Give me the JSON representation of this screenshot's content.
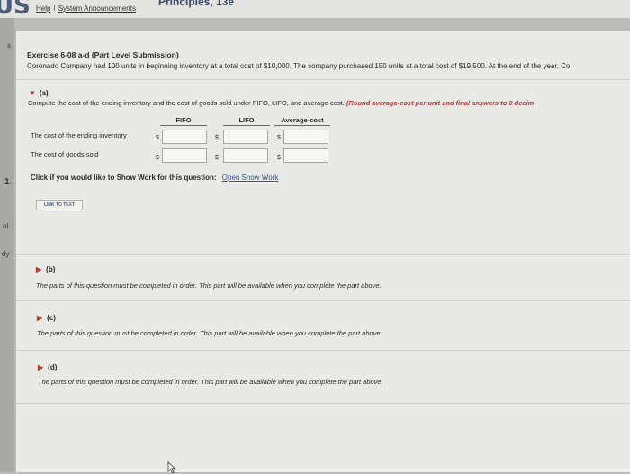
{
  "header": {
    "brand_text": "US",
    "course_title_fragment": "Principles, 13e",
    "help_link": "Help",
    "separator": "I",
    "announcements_link": "System Announcements"
  },
  "left_rail": {
    "marks": [
      "s",
      "1",
      "ol",
      "dy"
    ]
  },
  "exercise": {
    "title": "Exercise 6-08 a-d (Part Level Submission)",
    "intro": "Coronado Company had 100 units in beginning inventory at a total cost of $10,000. The company purchased 150 units at a total cost of $19,500. At the end of the year, Co"
  },
  "part_a": {
    "label": "(a)",
    "instruction": "Compute the cost of the ending inventory and the cost of goods sold under FIFO, LIFO, and average-cost.",
    "instruction_note": "(Round average-cost per unit and final answers to 0 decim",
    "columns": [
      "FIFO",
      "LIFO",
      "Average-cost"
    ],
    "rows": [
      {
        "label": "The cost of the ending inventory",
        "currency": [
          "$",
          "$",
          "$"
        ],
        "values": [
          "",
          "",
          ""
        ]
      },
      {
        "label": "The cost of goods sold",
        "currency": [
          "$",
          "$",
          "$"
        ],
        "values": [
          "",
          "",
          ""
        ]
      }
    ],
    "show_work_prompt": "Click if you would like to Show Work for this question:",
    "show_work_link": "Open Show Work",
    "link_to_text": "LINK TO TEXT"
  },
  "locked_parts": [
    {
      "label": "(b)",
      "message": "The parts of this question must be completed in order. This part will be available when you complete the part above."
    },
    {
      "label": "(c)",
      "message": "The parts of this question must be completed in order. This part will be available when you complete the part above."
    },
    {
      "label": "(d)",
      "message": "The parts of this question must be completed in order. This part will be available when you complete the part above."
    }
  ],
  "colors": {
    "accent_red": "#c0392b",
    "link_blue": "#34568f",
    "panel_bg": "#e9e9e6"
  }
}
